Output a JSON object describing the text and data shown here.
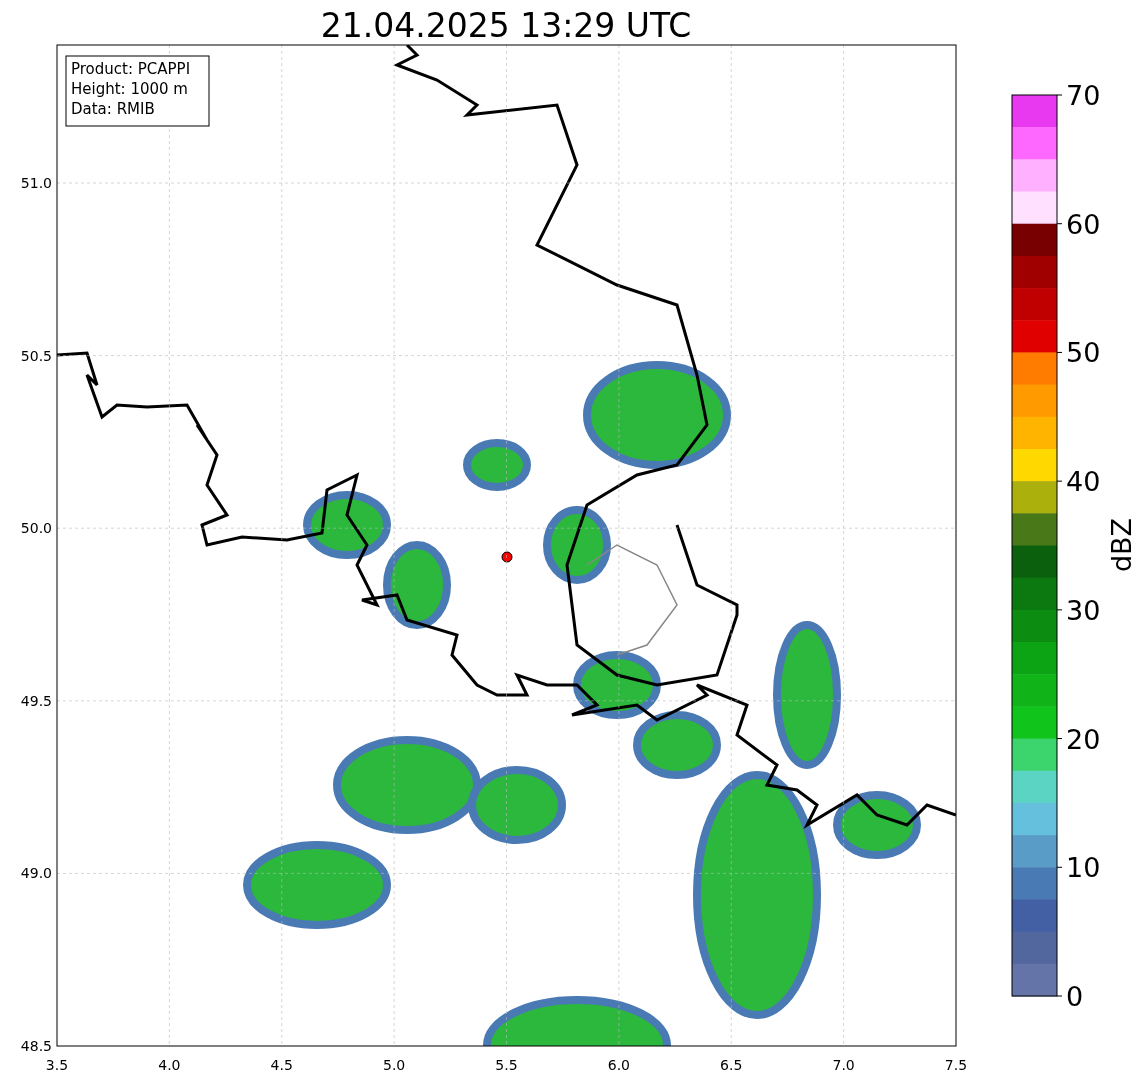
{
  "title": "21.04.2025 13:29 UTC",
  "info_box": [
    "Product: PCAPPI",
    "Height: 1000 m",
    "Data: RMIB"
  ],
  "map": {
    "x_ticks": [
      "3.5",
      "4.0",
      "4.5",
      "5.0",
      "5.5",
      "6.0",
      "6.5",
      "7.0",
      "7.5"
    ],
    "y_ticks": [
      "51.0",
      "50.5",
      "50.0",
      "49.5",
      "49.0",
      "48.5"
    ]
  },
  "colorbar": {
    "label": "dBZ",
    "ticks": [
      "70",
      "60",
      "50",
      "40",
      "30",
      "20",
      "10",
      "0"
    ],
    "bands": [
      {
        "color": "#e838f0"
      },
      {
        "color": "#ff68ff"
      },
      {
        "color": "#ffb0ff"
      },
      {
        "color": "#ffe0ff"
      },
      {
        "color": "#780000"
      },
      {
        "color": "#a00000"
      },
      {
        "color": "#c00000"
      },
      {
        "color": "#e00000"
      },
      {
        "color": "#ff7c00"
      },
      {
        "color": "#ff9a00"
      },
      {
        "color": "#ffb400"
      },
      {
        "color": "#ffd800"
      },
      {
        "color": "#acb00c"
      },
      {
        "color": "#487818"
      },
      {
        "color": "#0a600c"
      },
      {
        "color": "#0c7810"
      },
      {
        "color": "#0c8c10"
      },
      {
        "color": "#0ca414"
      },
      {
        "color": "#10b418"
      },
      {
        "color": "#10c41c"
      },
      {
        "color": "#3cd46c"
      },
      {
        "color": "#5cd4c4"
      },
      {
        "color": "#64c0dc"
      },
      {
        "color": "#5a9cc8"
      },
      {
        "color": "#4a7ab4"
      },
      {
        "color": "#4460a4"
      },
      {
        "color": "#53679f"
      },
      {
        "color": "#6474a8"
      }
    ]
  }
}
